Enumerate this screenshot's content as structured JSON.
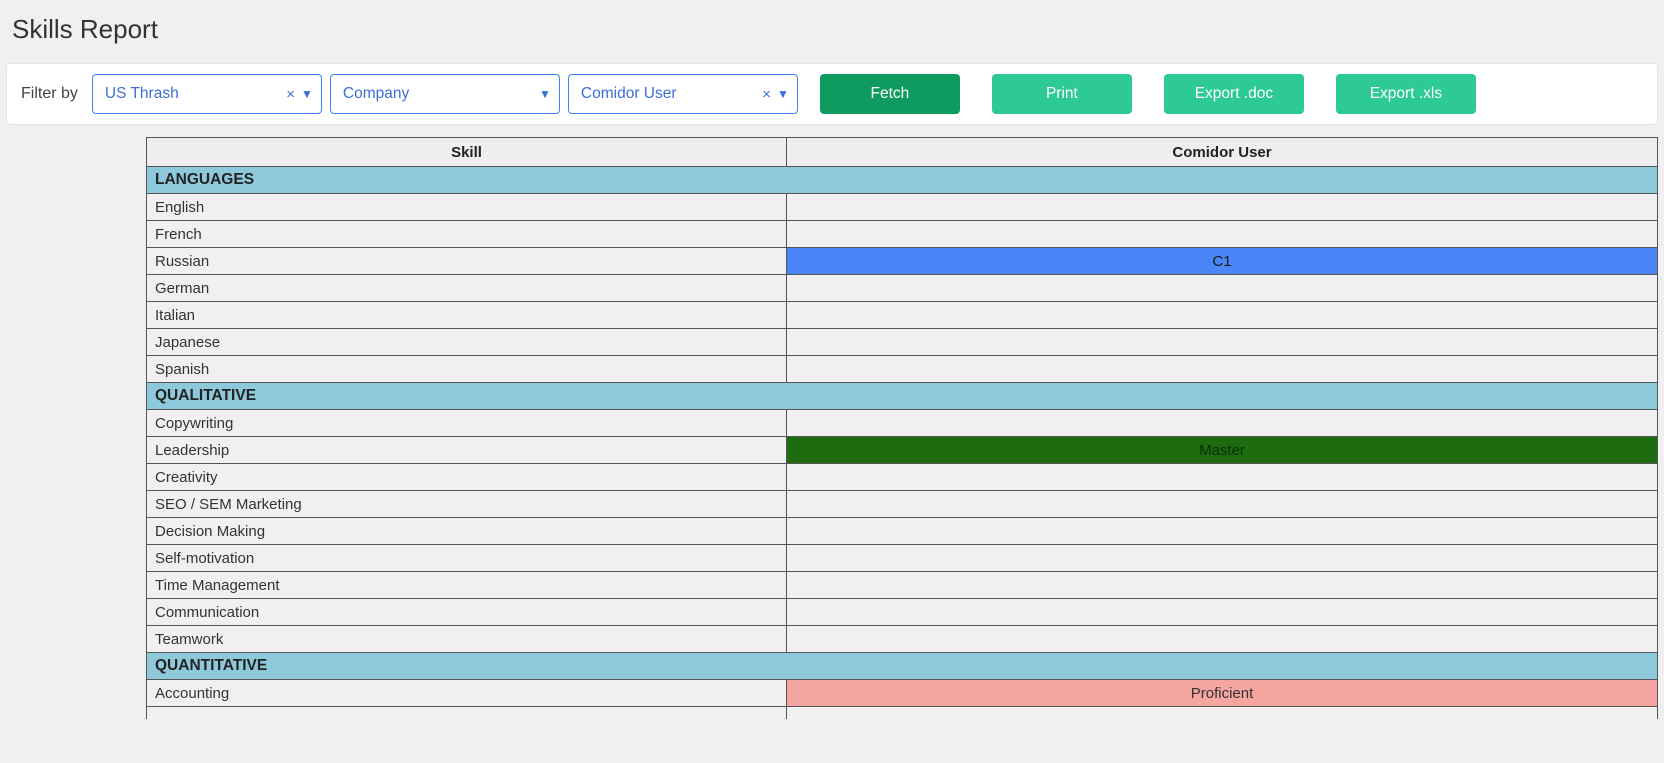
{
  "title": "Skills Report",
  "filter": {
    "label": "Filter by",
    "dropdown1": {
      "value": "US Thrash",
      "clearable": true
    },
    "dropdown2": {
      "value": "Company",
      "clearable": false
    },
    "dropdown3": {
      "value": "Comidor User",
      "clearable": true
    }
  },
  "buttons": {
    "fetch": "Fetch",
    "print": "Print",
    "export_doc": "Export .doc",
    "export_xls": "Export .xls"
  },
  "table": {
    "headers": {
      "skill": "Skill",
      "user": "Comidor User"
    },
    "sections": [
      {
        "category": "LANGUAGES",
        "rows": [
          {
            "skill": "English",
            "level": "",
            "levelClass": ""
          },
          {
            "skill": "French",
            "level": "",
            "levelClass": ""
          },
          {
            "skill": "Russian",
            "level": "C1",
            "levelClass": "level-c1"
          },
          {
            "skill": "German",
            "level": "",
            "levelClass": ""
          },
          {
            "skill": "Italian",
            "level": "",
            "levelClass": ""
          },
          {
            "skill": "Japanese",
            "level": "",
            "levelClass": ""
          },
          {
            "skill": "Spanish",
            "level": "",
            "levelClass": ""
          }
        ]
      },
      {
        "category": "QUALITATIVE",
        "rows": [
          {
            "skill": "Copywriting",
            "level": "",
            "levelClass": ""
          },
          {
            "skill": "Leadership",
            "level": "Master",
            "levelClass": "level-master"
          },
          {
            "skill": "Creativity",
            "level": "",
            "levelClass": ""
          },
          {
            "skill": "SEO / SEM Marketing",
            "level": "",
            "levelClass": ""
          },
          {
            "skill": "Decision Making",
            "level": "",
            "levelClass": ""
          },
          {
            "skill": "Self-motivation",
            "level": "",
            "levelClass": ""
          },
          {
            "skill": "Time Management",
            "level": "",
            "levelClass": ""
          },
          {
            "skill": "Communication",
            "level": "",
            "levelClass": ""
          },
          {
            "skill": "Teamwork",
            "level": "",
            "levelClass": ""
          }
        ]
      },
      {
        "category": "QUANTITATIVE",
        "rows": [
          {
            "skill": "Accounting",
            "level": "Proficient",
            "levelClass": "level-proficient"
          }
        ]
      }
    ]
  }
}
